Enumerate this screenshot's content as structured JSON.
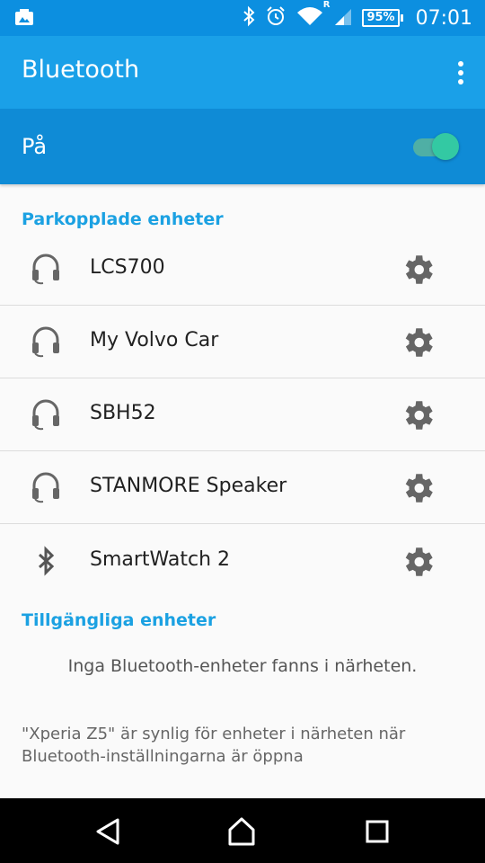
{
  "status_bar": {
    "time": "07:01",
    "battery": "95%",
    "roaming": "R",
    "icons": [
      "photo-notification-icon",
      "bluetooth-icon",
      "alarm-icon",
      "wifi-icon",
      "signal-icon",
      "battery-icon"
    ]
  },
  "app_bar": {
    "title": "Bluetooth",
    "menu_icon": "overflow-menu-icon"
  },
  "toggle": {
    "label": "På",
    "state": "on",
    "accent": "#33c9a3"
  },
  "paired": {
    "header": "Parkopplade enheter",
    "devices": [
      {
        "name": "LCS700",
        "icon": "headset-icon"
      },
      {
        "name": "My Volvo Car",
        "icon": "headset-icon"
      },
      {
        "name": "SBH52",
        "icon": "headset-icon"
      },
      {
        "name": "STANMORE Speaker",
        "icon": "headset-icon"
      },
      {
        "name": "SmartWatch 2",
        "icon": "bluetooth-icon"
      }
    ]
  },
  "available": {
    "header": "Tillgängliga enheter",
    "empty_text": "Inga Bluetooth-enheter fanns i närheten."
  },
  "visibility_text": "\"Xperia Z5\" är synlig för enheter i närheten när Bluetooth-inställningarna är öppna",
  "colors": {
    "status_bar": "#0c8fe0",
    "app_bar": "#1aa0e8",
    "toggle_bar": "#0f8bd6",
    "section_header": "#1ba1e2"
  },
  "nav": {
    "icons": [
      "back-icon",
      "home-icon",
      "recents-icon"
    ]
  }
}
